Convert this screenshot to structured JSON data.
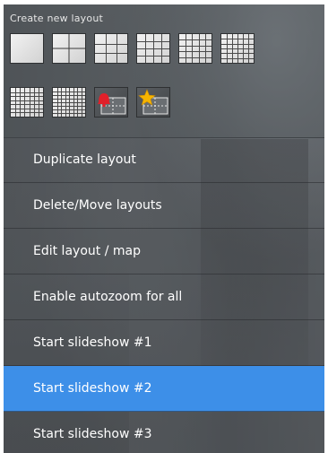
{
  "header": {
    "label": "Create new layout",
    "layout_tiles": [
      {
        "icon": "layout-1x1-icon"
      },
      {
        "icon": "layout-2x2-icon"
      },
      {
        "icon": "layout-3x3-icon"
      },
      {
        "icon": "layout-4x4-icon"
      },
      {
        "icon": "layout-5x5-icon"
      },
      {
        "icon": "layout-6x6-icon"
      },
      {
        "icon": "layout-7x7-icon"
      },
      {
        "icon": "layout-8x8-icon"
      },
      {
        "icon": "alarm-layout-icon"
      },
      {
        "icon": "favorite-layout-icon"
      }
    ]
  },
  "menu": {
    "items": [
      {
        "label": "Duplicate layout"
      },
      {
        "label": "Delete/Move layouts"
      },
      {
        "label": "Edit layout / map"
      },
      {
        "label": "Enable autozoom for all"
      },
      {
        "label": "Start slideshow #1"
      },
      {
        "label": "Start slideshow #2",
        "selected": true
      },
      {
        "label": "Start slideshow #3"
      }
    ]
  },
  "colors": {
    "selected_bg": "#3d8fe8",
    "panel_bg": "#4e5357",
    "alarm_red": "#e0202a",
    "star_yellow": "#f5b400"
  }
}
